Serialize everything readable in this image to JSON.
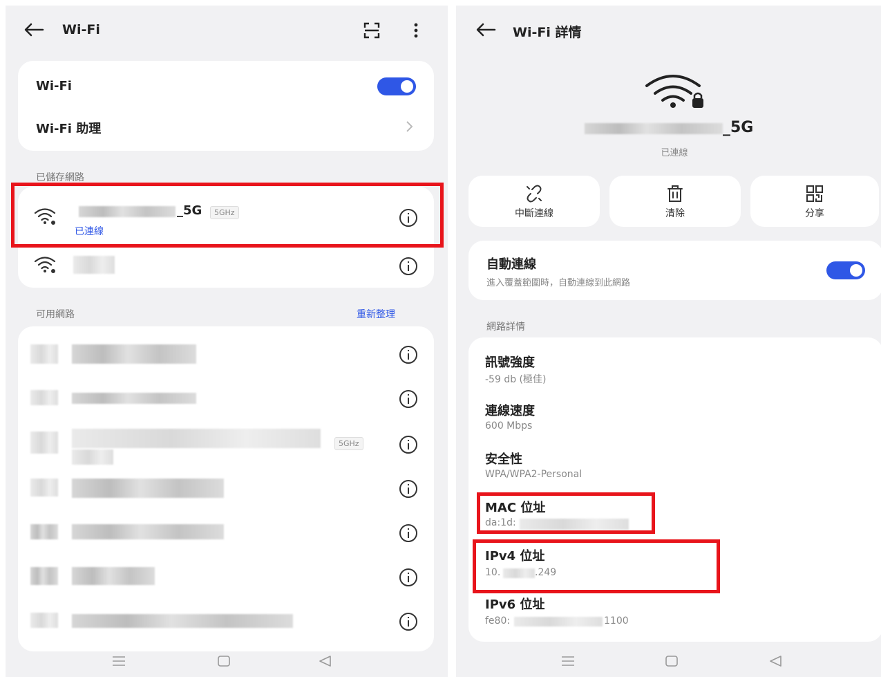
{
  "left": {
    "title": "Wi-Fi",
    "wifi_label": "Wi-Fi",
    "wifi_assistant_label": "Wi-Fi 助理",
    "saved_section": "已儲存網路",
    "saved_networks": [
      {
        "ssid_suffix": "_5G",
        "band": "5GHz",
        "status": "已連線"
      },
      {
        "ssid_suffix": ""
      }
    ],
    "available_section": "可用網路",
    "refresh_label": "重新整理",
    "available_networks": [
      {
        "band": ""
      },
      {
        "band": ""
      },
      {
        "band": "5GHz"
      },
      {
        "band": ""
      },
      {
        "band": ""
      },
      {
        "band": ""
      },
      {
        "band": ""
      }
    ]
  },
  "right": {
    "title": "Wi-Fi 詳情",
    "ssid_suffix": "_5G",
    "status": "已連線",
    "actions": [
      {
        "label": "中斷連線",
        "icon": "unlink-icon"
      },
      {
        "label": "清除",
        "icon": "trash-icon"
      },
      {
        "label": "分享",
        "icon": "qr-code-icon"
      }
    ],
    "auto_connect": {
      "title": "自動連線",
      "description": "進入覆蓋範圍時，自動連線到此網路"
    },
    "details_section": "網路詳情",
    "details": [
      {
        "title": "訊號強度",
        "value": "-59 db (極佳)"
      },
      {
        "title": "連線速度",
        "value": "600 Mbps"
      },
      {
        "title": "安全性",
        "value": "WPA/WPA2-Personal"
      },
      {
        "title": "MAC 位址",
        "value_prefix": "da:1d:"
      },
      {
        "title": "IPv4 位址",
        "value_prefix": "10.",
        "value_suffix": ".249"
      },
      {
        "title": "IPv6 位址",
        "value_prefix": "fe80:",
        "value_suffix": "1100"
      }
    ]
  },
  "colors": {
    "accent": "#2f57e6",
    "highlight": "#e8141b",
    "background": "#f1f1f3"
  }
}
